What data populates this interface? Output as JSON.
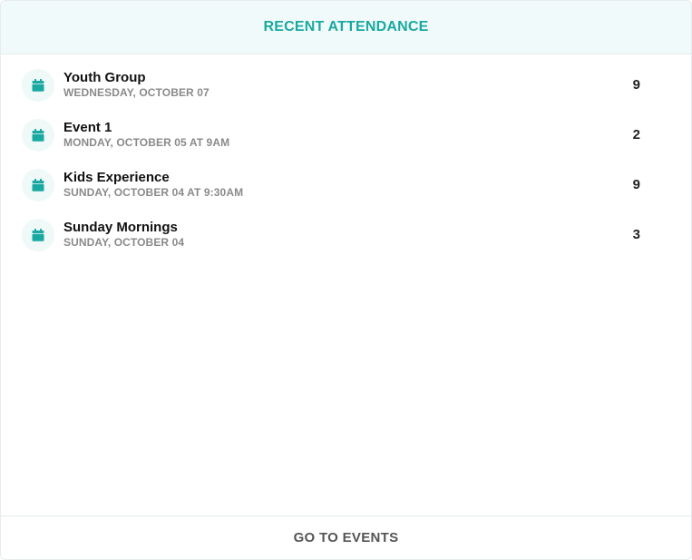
{
  "header": {
    "title": "RECENT ATTENDANCE"
  },
  "colors": {
    "accent": "#1aa9a0",
    "header_bg": "#f1fafa",
    "icon_bg": "#eef9f8"
  },
  "events": [
    {
      "name": "Youth Group",
      "date": "WEDNESDAY, OCTOBER 07",
      "count": "9",
      "icon": "calendar-icon"
    },
    {
      "name": "Event 1",
      "date": "MONDAY, OCTOBER 05 AT 9AM",
      "count": "2",
      "icon": "calendar-icon"
    },
    {
      "name": "Kids Experience",
      "date": "SUNDAY, OCTOBER 04 AT 9:30AM",
      "count": "9",
      "icon": "calendar-icon"
    },
    {
      "name": "Sunday Mornings",
      "date": "SUNDAY, OCTOBER 04",
      "count": "3",
      "icon": "calendar-icon"
    }
  ],
  "footer": {
    "label": "GO TO EVENTS"
  }
}
